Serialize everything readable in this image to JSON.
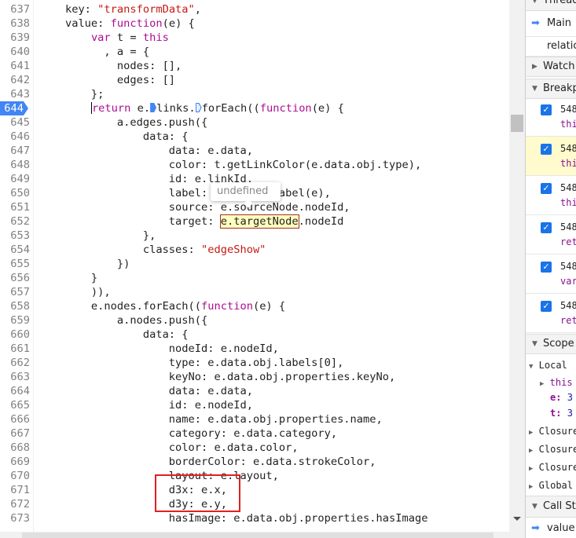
{
  "editor": {
    "current_line": 644,
    "tooltip": "undefined",
    "lines": [
      {
        "n": "637",
        "t": [
          {
            "s": "    key: "
          },
          {
            "s": "\"transformData\"",
            "c": "str"
          },
          {
            "s": ","
          }
        ]
      },
      {
        "n": "638",
        "t": [
          {
            "s": "    value: "
          },
          {
            "s": "function",
            "c": "kw"
          },
          {
            "s": "(e) {"
          }
        ]
      },
      {
        "n": "639",
        "t": [
          {
            "s": "        "
          },
          {
            "s": "var",
            "c": "kw"
          },
          {
            "s": " t = "
          },
          {
            "s": "this",
            "c": "kw"
          }
        ]
      },
      {
        "n": "640",
        "t": [
          {
            "s": "          , a = {"
          }
        ]
      },
      {
        "n": "641",
        "t": [
          {
            "s": "            nodes: [],"
          }
        ]
      },
      {
        "n": "642",
        "t": [
          {
            "s": "            edges: []"
          }
        ]
      },
      {
        "n": "643",
        "t": [
          {
            "s": "        };"
          }
        ]
      },
      {
        "n": "644",
        "t": [
          {
            "s": "        "
          },
          {
            "cursor": true
          },
          {
            "s": "return",
            "c": "kw"
          },
          {
            "s": " e."
          },
          {
            "marker": "on"
          },
          {
            "s": "links."
          },
          {
            "marker": "off"
          },
          {
            "s": "forEach(("
          },
          {
            "s": "function",
            "c": "kw"
          },
          {
            "s": "(e) {"
          }
        ]
      },
      {
        "n": "645",
        "t": [
          {
            "s": "            a.edges.push({"
          }
        ]
      },
      {
        "n": "646",
        "t": [
          {
            "s": "                data: {"
          }
        ]
      },
      {
        "n": "647",
        "t": [
          {
            "s": "                    data: e.data,"
          }
        ]
      },
      {
        "n": "648",
        "t": [
          {
            "s": "                    color: t.getLinkColor(e.data.obj.type),"
          }
        ]
      },
      {
        "n": "649",
        "t": [
          {
            "s": "                    id: e.linkId,"
          }
        ]
      },
      {
        "n": "650",
        "t": [
          {
            "s": "                    label: t.getLinkLabel(e),"
          }
        ]
      },
      {
        "n": "651",
        "t": [
          {
            "s": "                    source: e.sourceNode.nodeId,"
          }
        ]
      },
      {
        "n": "652",
        "t": [
          {
            "s": "                    target: "
          },
          {
            "s": "e.targetNode",
            "c": "hl"
          },
          {
            "s": ".nodeId"
          }
        ]
      },
      {
        "n": "653",
        "t": [
          {
            "s": "                },"
          }
        ]
      },
      {
        "n": "654",
        "t": [
          {
            "s": "                classes: "
          },
          {
            "s": "\"edgeShow\"",
            "c": "str"
          }
        ]
      },
      {
        "n": "655",
        "t": [
          {
            "s": "            })"
          }
        ]
      },
      {
        "n": "656",
        "t": [
          {
            "s": "        }"
          }
        ]
      },
      {
        "n": "657",
        "t": [
          {
            "s": "        )),"
          }
        ]
      },
      {
        "n": "658",
        "t": [
          {
            "s": "        e.nodes.forEach(("
          },
          {
            "s": "function",
            "c": "kw"
          },
          {
            "s": "(e) {"
          }
        ]
      },
      {
        "n": "659",
        "t": [
          {
            "s": "            a.nodes.push({"
          }
        ]
      },
      {
        "n": "660",
        "t": [
          {
            "s": "                data: {"
          }
        ]
      },
      {
        "n": "661",
        "t": [
          {
            "s": "                    nodeId: e.nodeId,"
          }
        ]
      },
      {
        "n": "662",
        "t": [
          {
            "s": "                    type: e.data.obj.labels[0],"
          }
        ]
      },
      {
        "n": "663",
        "t": [
          {
            "s": "                    keyNo: e.data.obj.properties.keyNo,"
          }
        ]
      },
      {
        "n": "664",
        "t": [
          {
            "s": "                    data: e.data,"
          }
        ]
      },
      {
        "n": "665",
        "t": [
          {
            "s": "                    id: e.nodeId,"
          }
        ]
      },
      {
        "n": "666",
        "t": [
          {
            "s": "                    name: e.data.obj.properties.name,"
          }
        ]
      },
      {
        "n": "667",
        "t": [
          {
            "s": "                    category: e.data.category,"
          }
        ]
      },
      {
        "n": "668",
        "t": [
          {
            "s": "                    color: e.data.color,"
          }
        ]
      },
      {
        "n": "669",
        "t": [
          {
            "s": "                    borderColor: e.data.strokeColor,"
          }
        ]
      },
      {
        "n": "670",
        "t": [
          {
            "s": "                    layout: e.layout,"
          }
        ]
      },
      {
        "n": "671",
        "t": [
          {
            "s": "                    d3x: e.x,"
          }
        ]
      },
      {
        "n": "672",
        "t": [
          {
            "s": "                    d3y: e.y,"
          }
        ]
      },
      {
        "n": "673",
        "t": [
          {
            "s": "                    hasImage: e.data.obj.properties.hasImage"
          }
        ]
      }
    ]
  },
  "panel": {
    "threads_header": "Threads",
    "threads": [
      "Main",
      "relation"
    ],
    "watch_header": "Watch",
    "breakpoints_header": "Breakpoints",
    "breakpoints": [
      {
        "line": "548",
        "code": "this",
        "checked": true
      },
      {
        "line": "548",
        "code": "this",
        "checked": true,
        "active": true
      },
      {
        "line": "548",
        "code": "this",
        "checked": true
      },
      {
        "line": "548",
        "code": "ret",
        "checked": true
      },
      {
        "line": "548",
        "code": "var",
        "checked": true
      },
      {
        "line": "548",
        "code": "ret",
        "checked": true
      }
    ],
    "scope_header": "Scope",
    "local_label": "Local",
    "this_label": "this",
    "e_label": "e:",
    "e_value": "3",
    "t_label": "t:",
    "t_value": "3",
    "closures": [
      "Closure",
      "Closure",
      "Closure"
    ],
    "global_label": "Global",
    "callstack_header": "Call Stack",
    "callstack": [
      "value"
    ]
  }
}
